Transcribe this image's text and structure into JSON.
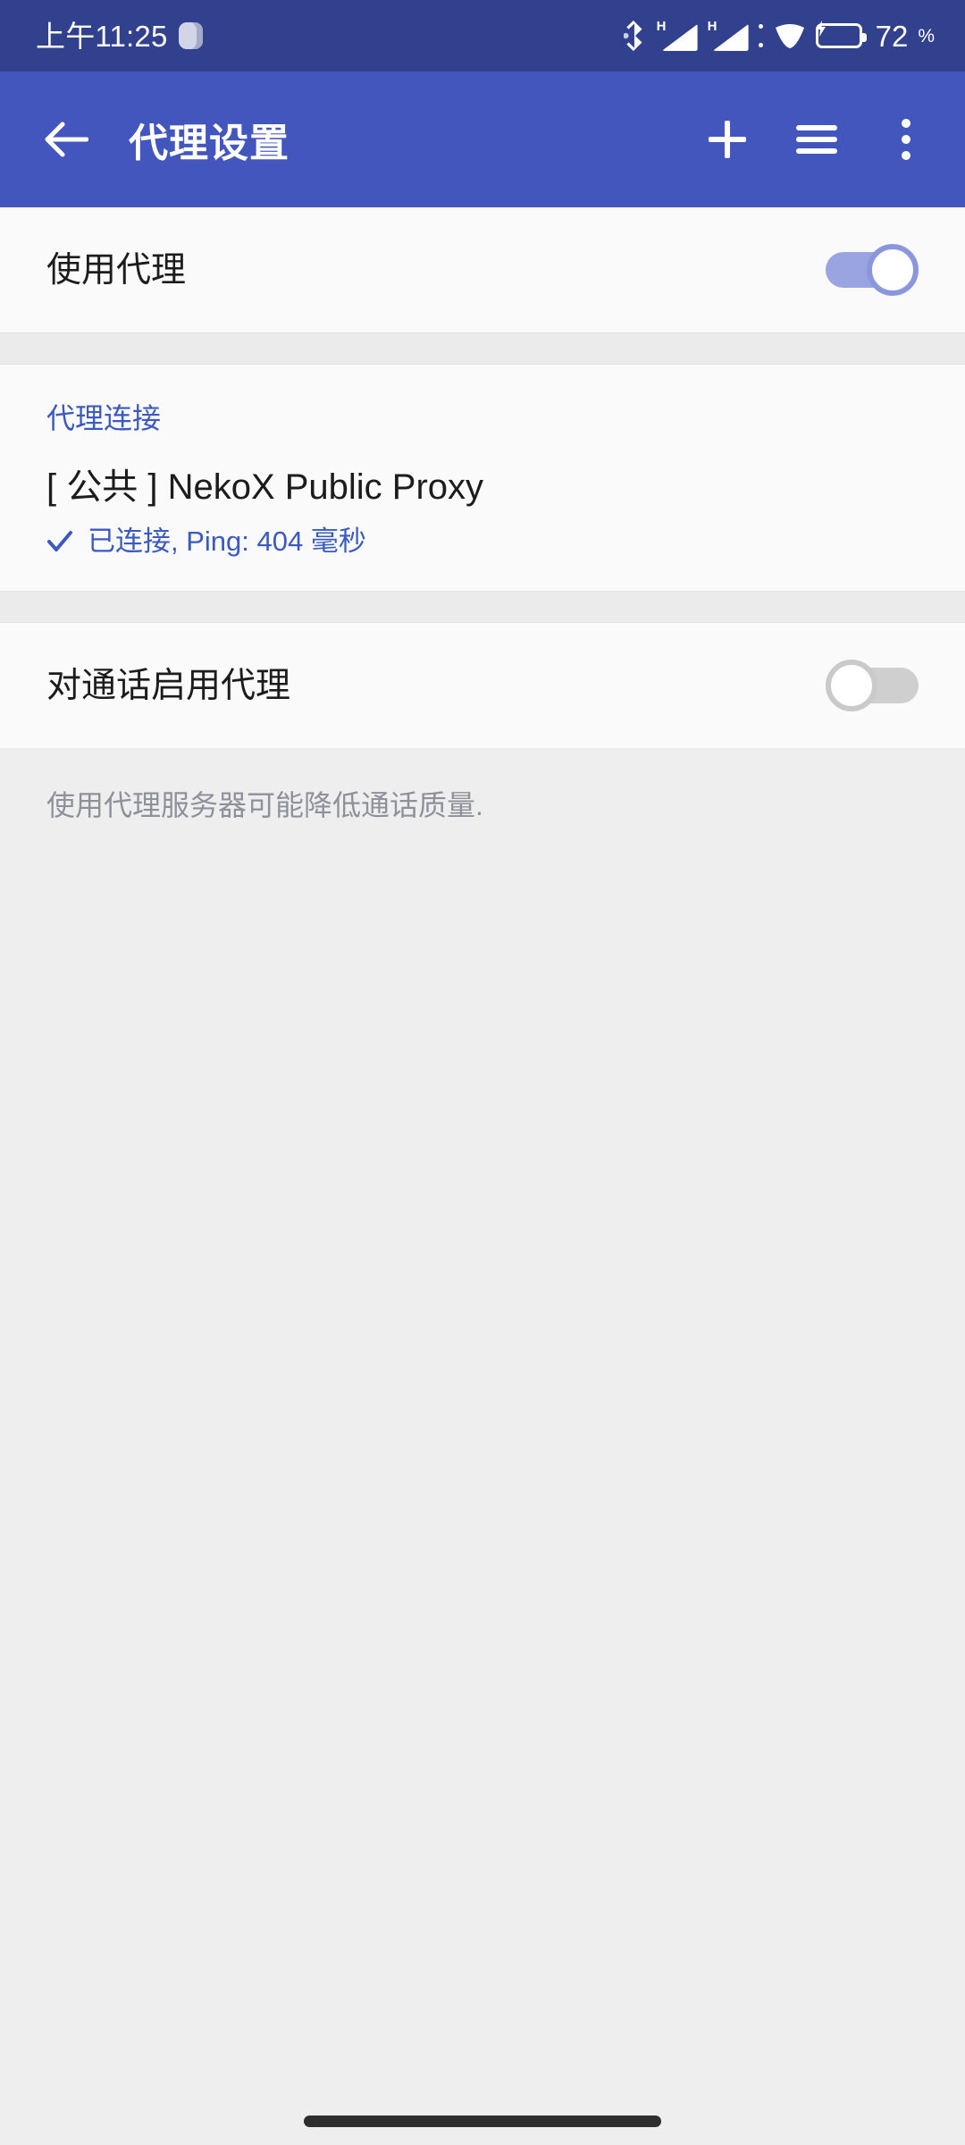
{
  "status_bar": {
    "clock": "上午11:25",
    "notification_icon": "notification-pill-icon",
    "icons": [
      "bluetooth-icon",
      "signal-1-icon",
      "signal-2-icon",
      "wifi-icon",
      "battery-charging-icon"
    ],
    "network_type_1": "H",
    "network_type_2": "H",
    "battery_percent": "72",
    "battery_unit": "%",
    "background_color": "#31418d"
  },
  "app_bar": {
    "back_icon": "back-arrow-icon",
    "title": "代理设置",
    "actions": [
      {
        "name": "add-proxy-button",
        "icon": "plus-icon"
      },
      {
        "name": "reorder-button",
        "icon": "hamburger-icon"
      },
      {
        "name": "overflow-menu-button",
        "icon": "three-dots-vertical-icon"
      }
    ],
    "background_color": "#4356bd"
  },
  "use_proxy_row": {
    "label": "使用代理",
    "toggle_state": "on",
    "toggle_on_color": "#9aa4e0"
  },
  "proxy_connection": {
    "section_header": "代理连接",
    "proxy_name": "[ 公共 ] NekoX Public Proxy",
    "status_icon": "check-icon",
    "status_text": "已连接, Ping: 404 毫秒",
    "accent_color": "#3b5ac0"
  },
  "calls_row": {
    "label": "对通话启用代理",
    "toggle_state": "off",
    "toggle_off_color": "#cfcfcf"
  },
  "footer": {
    "note": "使用代理服务器可能降低通话质量."
  },
  "navigation": {
    "gesture_pill": "home-gesture-pill"
  }
}
